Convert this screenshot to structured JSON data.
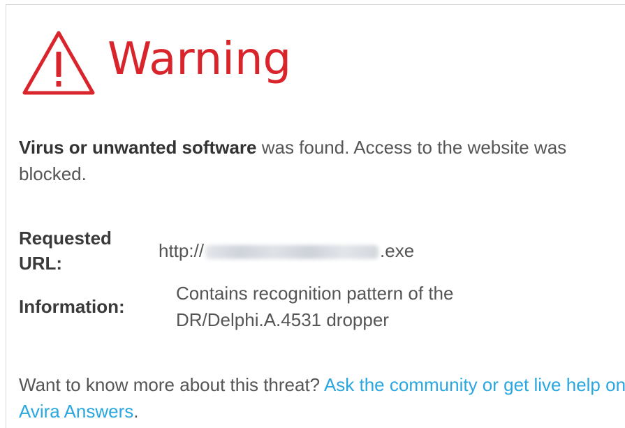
{
  "title": "Warning",
  "message": {
    "bold": "Virus or unwanted software",
    "rest": " was found. Access to the website was blocked."
  },
  "details": {
    "url_label": "Requested URL:",
    "url_prefix": "http://",
    "url_suffix": ".exe",
    "info_label": "Information:",
    "info_value": "Contains recognition pattern of the DR/Delphi.A.4531 dropper"
  },
  "more": {
    "text": "Want to know more about this threat? ",
    "link": "Ask the community or get live help on Avira Answers",
    "end": "."
  },
  "colors": {
    "warning_red": "#d8242a",
    "link_blue": "#2aa7e0",
    "text_gray": "#555555"
  },
  "icons": {
    "warning": "warning-triangle-icon"
  }
}
